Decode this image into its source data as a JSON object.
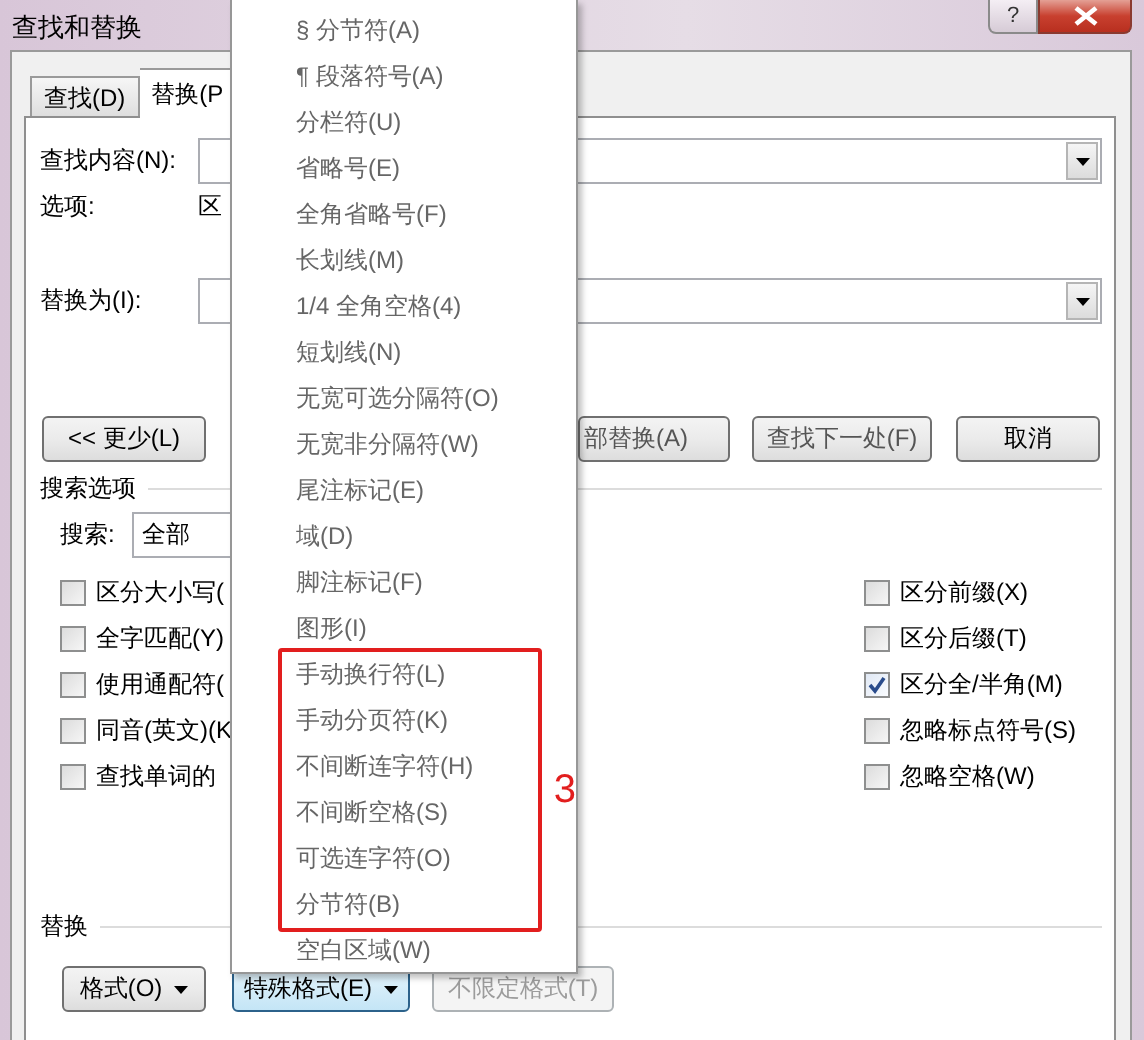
{
  "window": {
    "title": "查找和替换",
    "help": "?"
  },
  "tabs": [
    {
      "label": "查找(D)",
      "selected": false
    },
    {
      "label": "替换(P",
      "selected": true
    }
  ],
  "find": {
    "label": "查找内容(N):"
  },
  "options": {
    "label": "选项:",
    "value": "区"
  },
  "replace": {
    "label": "替换为(I):"
  },
  "buttons": [
    {
      "label": "<< 更少(L)"
    },
    {
      "label": "部替换(A)"
    },
    {
      "label": "查找下一处(F)"
    },
    {
      "label": "取消"
    }
  ],
  "search_options": {
    "title": "搜索选项",
    "search_label": "搜索:",
    "search_value": "全部",
    "left_checks": [
      {
        "label": "区分大小写(",
        "checked": false
      },
      {
        "label": "全字匹配(Y)",
        "checked": false
      },
      {
        "label": "使用通配符(",
        "checked": false
      },
      {
        "label": "同音(英文)(K",
        "checked": false
      },
      {
        "label": "查找单词的",
        "checked": false
      }
    ],
    "right_checks": [
      {
        "label": "区分前缀(X)",
        "checked": false
      },
      {
        "label": "区分后缀(T)",
        "checked": false
      },
      {
        "label": "区分全/半角(M)",
        "checked": true
      },
      {
        "label": "忽略标点符号(S)",
        "checked": false
      },
      {
        "label": "忽略空格(W)",
        "checked": false
      }
    ]
  },
  "replace_section": {
    "title": "替换",
    "buttons": [
      {
        "label": "格式(O)",
        "dropdown": true,
        "pressed": false,
        "disabled": false
      },
      {
        "label": "特殊格式(E)",
        "dropdown": true,
        "pressed": true,
        "disabled": false
      },
      {
        "label": "不限定格式(T)",
        "dropdown": false,
        "pressed": false,
        "disabled": true
      }
    ]
  },
  "menu": {
    "items": [
      {
        "label": "§ 分节符(A)",
        "boxed": false
      },
      {
        "label": "¶ 段落符号(A)",
        "boxed": false
      },
      {
        "label": "分栏符(U)",
        "boxed": false
      },
      {
        "label": "省略号(E)",
        "boxed": false
      },
      {
        "label": "全角省略号(F)",
        "boxed": false
      },
      {
        "label": "长划线(M)",
        "boxed": false
      },
      {
        "label": "1/4 全角空格(4)",
        "boxed": false
      },
      {
        "label": "短划线(N)",
        "boxed": false
      },
      {
        "label": "无宽可选分隔符(O)",
        "boxed": false
      },
      {
        "label": "无宽非分隔符(W)",
        "boxed": false
      },
      {
        "label": "尾注标记(E)",
        "boxed": false
      },
      {
        "label": "域(D)",
        "boxed": false
      },
      {
        "label": "脚注标记(F)",
        "boxed": false
      },
      {
        "label": "图形(I)",
        "boxed": false
      },
      {
        "label": "手动换行符(L)",
        "boxed": true
      },
      {
        "label": "手动分页符(K)",
        "boxed": true
      },
      {
        "label": "不间断连字符(H)",
        "boxed": true
      },
      {
        "label": "不间断空格(S)",
        "boxed": true
      },
      {
        "label": "可选连字符(O)",
        "boxed": true
      },
      {
        "label": "分节符(B)",
        "boxed": true
      },
      {
        "label": "空白区域(W)",
        "boxed": false
      }
    ],
    "annotation": {
      "label": "3"
    }
  }
}
